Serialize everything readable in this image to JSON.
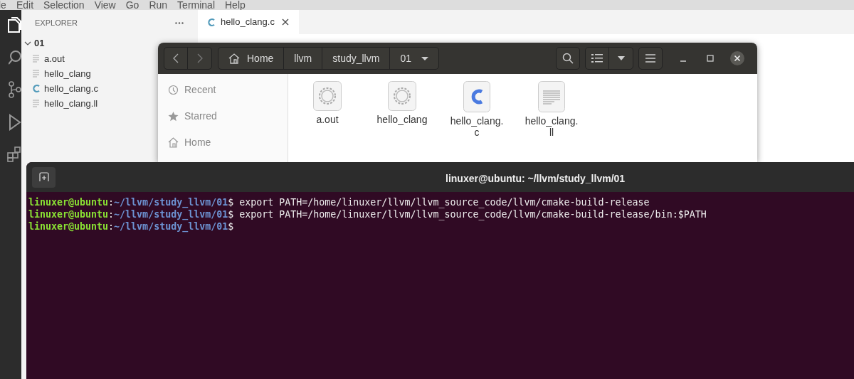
{
  "menu_bar": [
    "le",
    "Edit",
    "Selection",
    "View",
    "Go",
    "Run",
    "Terminal",
    "Help"
  ],
  "explorer": {
    "title": "EXPLORER",
    "folder": {
      "name": "01",
      "expanded": true,
      "children": [
        {
          "name": "a.out",
          "kind": "text"
        },
        {
          "name": "hello_clang",
          "kind": "text"
        },
        {
          "name": "hello_clang.c",
          "kind": "c"
        },
        {
          "name": "hello_clang.ll",
          "kind": "text"
        }
      ]
    }
  },
  "editor": {
    "tabs": [
      {
        "label": "hello_clang.c",
        "kind": "c",
        "selected": true
      }
    ]
  },
  "file_manager": {
    "path": [
      {
        "label": "Home",
        "kind": "home"
      },
      {
        "label": "llvm",
        "kind": "folder"
      },
      {
        "label": "study_llvm",
        "kind": "folder"
      },
      {
        "label": "01",
        "kind": "current"
      }
    ],
    "places": [
      {
        "label": "Recent",
        "kind": "recent"
      },
      {
        "label": "Starred",
        "kind": "starred"
      },
      {
        "label": "Home",
        "kind": "home"
      }
    ],
    "files": [
      {
        "name": "a.out",
        "kind": "executable"
      },
      {
        "name": "hello_clang",
        "kind": "executable"
      },
      {
        "name": "hello_clang.c",
        "kind": "c"
      },
      {
        "name": "hello_clang.ll",
        "kind": "text"
      }
    ]
  },
  "terminal": {
    "title": "linuxer@ubuntu: ~/llvm/study_llvm/01",
    "lines": [
      {
        "user": "linuxer@ubuntu",
        "sep": ":",
        "path": "~/llvm/study_llvm/01",
        "prompt": "$",
        "command": "export PATH=/home/linuxer/llvm/llvm_source_code/llvm/cmake-build-release"
      },
      {
        "user": "linuxer@ubuntu",
        "sep": ":",
        "path": "~/llvm/study_llvm/01",
        "prompt": "$",
        "command": "export PATH=/home/linuxer/llvm/llvm_source_code/llvm/cmake-build-release/bin:$PATH"
      },
      {
        "user": "linuxer@ubuntu",
        "sep": ":",
        "path": "~/llvm/study_llvm/01",
        "prompt": "$"
      }
    ]
  }
}
